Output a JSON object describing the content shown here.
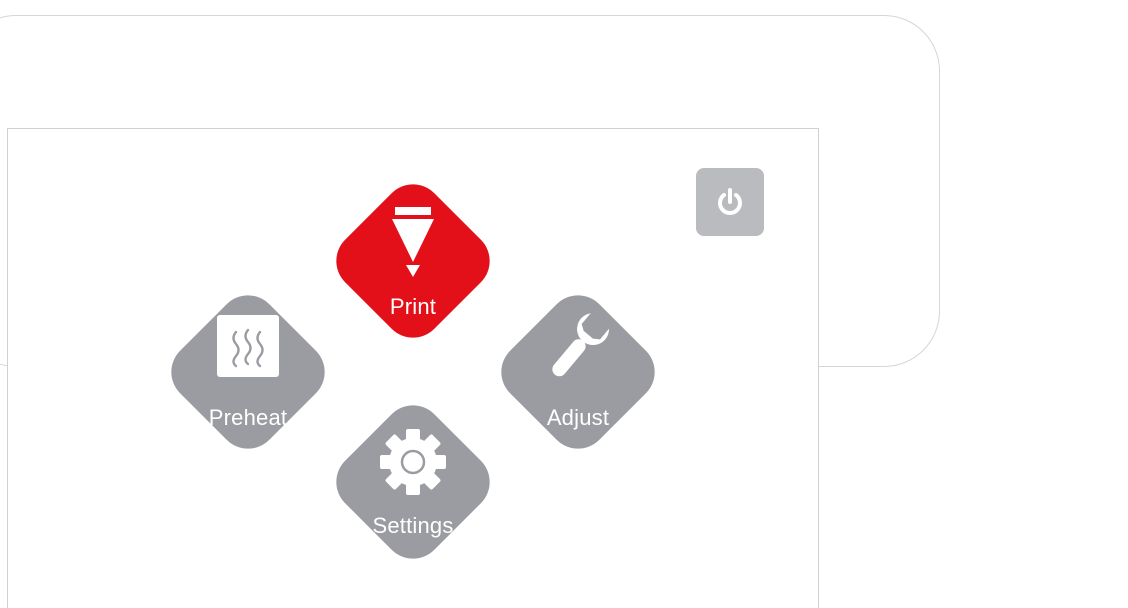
{
  "colors": {
    "accent": "#e3101a",
    "tile_gray": "#9a9ca1",
    "power_gray": "#b9bbbe",
    "outline": "#d4d6d8"
  },
  "menu": {
    "print_label": "Print",
    "preheat_label": "Preheat",
    "adjust_label": "Adjust",
    "settings_label": "Settings"
  },
  "icons": {
    "power": "power-icon",
    "print": "nozzle-icon",
    "preheat": "heat-waves-icon",
    "adjust": "wrench-icon",
    "settings": "gear-icon"
  }
}
